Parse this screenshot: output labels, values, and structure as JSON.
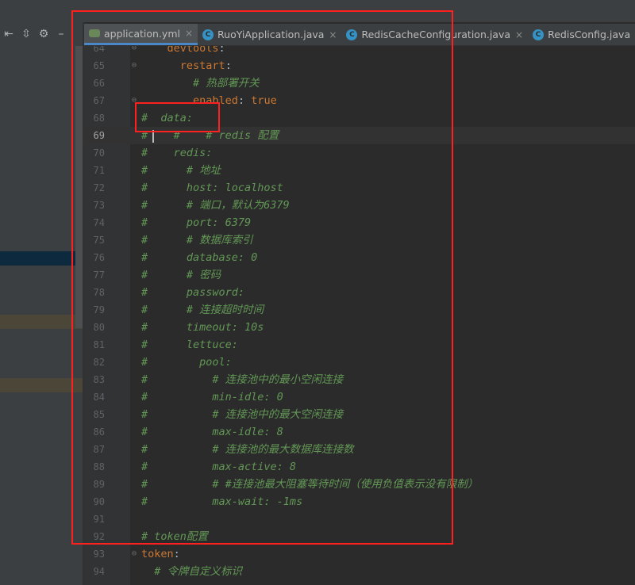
{
  "tool_strip": {
    "icons": [
      "collapse-all-icon",
      "expand-all-icon",
      "gear-icon",
      "hide-icon"
    ]
  },
  "tabs": [
    {
      "label": "application.yml",
      "icon": "yml-file-icon",
      "active": true,
      "close": "×"
    },
    {
      "label": "RuoYiApplication.java",
      "icon": "class-icon",
      "active": false,
      "close": "×"
    },
    {
      "label": "RedisCacheConfiguration.java",
      "icon": "class-icon",
      "active": false,
      "close": "×"
    },
    {
      "label": "RedisConfig.java",
      "icon": "class-icon",
      "active": false,
      "close": "×"
    }
  ],
  "editor": {
    "current_line": 69,
    "lines": [
      {
        "num": "64",
        "tokens": [
          {
            "t": "    ",
            "c": "plain"
          },
          {
            "t": "devtools",
            "c": "key"
          },
          {
            "t": ":",
            "c": "plain"
          }
        ]
      },
      {
        "num": "65",
        "tokens": [
          {
            "t": "      ",
            "c": "plain"
          },
          {
            "t": "restart",
            "c": "key"
          },
          {
            "t": ":",
            "c": "plain"
          }
        ]
      },
      {
        "num": "66",
        "tokens": [
          {
            "t": "        # 热部署开关",
            "c": "comment"
          }
        ]
      },
      {
        "num": "67",
        "tokens": [
          {
            "t": "        ",
            "c": "plain"
          },
          {
            "t": "enabled",
            "c": "key"
          },
          {
            "t": ": ",
            "c": "plain"
          },
          {
            "t": "true",
            "c": "val"
          }
        ]
      },
      {
        "num": "68",
        "tokens": [
          {
            "t": "#  data:",
            "c": "comment"
          }
        ]
      },
      {
        "num": "69",
        "tokens": [
          {
            "t": "#    #    # redis 配置",
            "c": "comment"
          }
        ]
      },
      {
        "num": "70",
        "tokens": [
          {
            "t": "#    redis:",
            "c": "comment"
          }
        ]
      },
      {
        "num": "71",
        "tokens": [
          {
            "t": "#      # 地址",
            "c": "comment"
          }
        ]
      },
      {
        "num": "72",
        "tokens": [
          {
            "t": "#      host: localhost",
            "c": "comment"
          }
        ]
      },
      {
        "num": "73",
        "tokens": [
          {
            "t": "#      # 端口，默认为6379",
            "c": "comment"
          }
        ]
      },
      {
        "num": "74",
        "tokens": [
          {
            "t": "#      port: 6379",
            "c": "comment"
          }
        ]
      },
      {
        "num": "75",
        "tokens": [
          {
            "t": "#      # 数据库索引",
            "c": "comment"
          }
        ]
      },
      {
        "num": "76",
        "tokens": [
          {
            "t": "#      database: 0",
            "c": "comment"
          }
        ]
      },
      {
        "num": "77",
        "tokens": [
          {
            "t": "#      # 密码",
            "c": "comment"
          }
        ]
      },
      {
        "num": "78",
        "tokens": [
          {
            "t": "#      password:",
            "c": "comment"
          }
        ]
      },
      {
        "num": "79",
        "tokens": [
          {
            "t": "#      # 连接超时时间",
            "c": "comment"
          }
        ]
      },
      {
        "num": "80",
        "tokens": [
          {
            "t": "#      timeout: 10s",
            "c": "comment"
          }
        ]
      },
      {
        "num": "81",
        "tokens": [
          {
            "t": "#      lettuce:",
            "c": "comment"
          }
        ]
      },
      {
        "num": "82",
        "tokens": [
          {
            "t": "#        pool:",
            "c": "comment"
          }
        ]
      },
      {
        "num": "83",
        "tokens": [
          {
            "t": "#          # 连接池中的最小空闲连接",
            "c": "comment"
          }
        ]
      },
      {
        "num": "84",
        "tokens": [
          {
            "t": "#          min-idle: 0",
            "c": "comment"
          }
        ]
      },
      {
        "num": "85",
        "tokens": [
          {
            "t": "#          # 连接池中的最大空闲连接",
            "c": "comment"
          }
        ]
      },
      {
        "num": "86",
        "tokens": [
          {
            "t": "#          max-idle: 8",
            "c": "comment"
          }
        ]
      },
      {
        "num": "87",
        "tokens": [
          {
            "t": "#          # 连接池的最大数据库连接数",
            "c": "comment"
          }
        ]
      },
      {
        "num": "88",
        "tokens": [
          {
            "t": "#          max-active: 8",
            "c": "comment"
          }
        ]
      },
      {
        "num": "89",
        "tokens": [
          {
            "t": "#          # #连接池最大阻塞等待时间（使用负值表示没有限制）",
            "c": "comment"
          }
        ]
      },
      {
        "num": "90",
        "tokens": [
          {
            "t": "#          max-wait: -1ms",
            "c": "comment"
          }
        ]
      },
      {
        "num": "91",
        "tokens": []
      },
      {
        "num": "92",
        "tokens": [
          {
            "t": "# token配置",
            "c": "comment"
          }
        ]
      },
      {
        "num": "93",
        "tokens": [
          {
            "t": "token",
            "c": "key"
          },
          {
            "t": ":",
            "c": "plain"
          }
        ]
      },
      {
        "num": "94",
        "tokens": [
          {
            "t": "  # 令牌自定义标识",
            "c": "comment"
          }
        ]
      }
    ]
  },
  "colors": {
    "annotation_red": "#ff2020",
    "comment_green": "#629755",
    "keyword_orange": "#cc7832",
    "tab_underline": "#4a88c7"
  }
}
